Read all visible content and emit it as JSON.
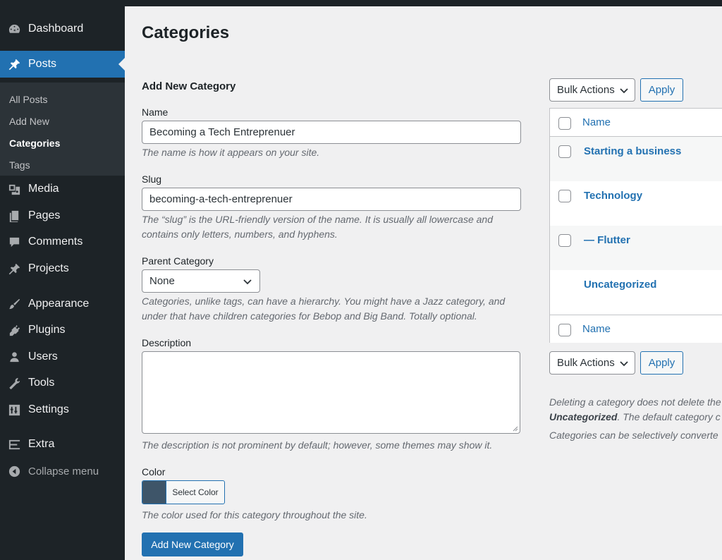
{
  "sidebar": {
    "items": [
      {
        "label": "Dashboard",
        "icon": "dashboard-icon"
      },
      {
        "label": "Posts",
        "icon": "pin-icon"
      },
      {
        "label": "Media",
        "icon": "media-icon"
      },
      {
        "label": "Pages",
        "icon": "pages-icon"
      },
      {
        "label": "Comments",
        "icon": "comments-icon"
      },
      {
        "label": "Projects",
        "icon": "pin-icon"
      },
      {
        "label": "Appearance",
        "icon": "brush-icon"
      },
      {
        "label": "Plugins",
        "icon": "plugin-icon"
      },
      {
        "label": "Users",
        "icon": "user-icon"
      },
      {
        "label": "Tools",
        "icon": "wrench-icon"
      },
      {
        "label": "Settings",
        "icon": "settings-icon"
      },
      {
        "label": "Extra",
        "icon": "extra-icon"
      }
    ],
    "submenu": [
      "All Posts",
      "Add New",
      "Categories",
      "Tags"
    ],
    "collapse_label": "Collapse menu"
  },
  "page": {
    "title": "Categories"
  },
  "form": {
    "title": "Add New Category",
    "name_label": "Name",
    "name_value": "Becoming a Tech Entreprenuer",
    "name_help": "The name is how it appears on your site.",
    "slug_label": "Slug",
    "slug_value": "becoming-a-tech-entreprenuer",
    "slug_help": "The “slug” is the URL-friendly version of the name. It is usually all lowercase and contains only letters, numbers, and hyphens.",
    "parent_label": "Parent Category",
    "parent_value": "None",
    "parent_help": "Categories, unlike tags, can have a hierarchy. You might have a Jazz category, and under that have children categories for Bebop and Big Band. Totally optional.",
    "description_label": "Description",
    "description_help": "The description is not prominent by default; however, some themes may show it.",
    "color_label": "Color",
    "color_button": "Select Color",
    "color_value": "#3e5569",
    "color_help": "The color used for this category throughout the site.",
    "submit_label": "Add New Category"
  },
  "list": {
    "bulk_actions": "Bulk Actions",
    "apply": "Apply",
    "column_name": "Name",
    "rows": [
      "Starting a business",
      "Technology",
      "— Flutter",
      "Uncategorized"
    ],
    "note_1a": "Deleting a category does not delete the",
    "note_1b": "Uncategorized",
    "note_1c": ". The default category c",
    "note_2": "Categories can be selectively converte"
  },
  "colors": {
    "accent": "#2271b1",
    "sidebar_bg": "#1d2327",
    "submenu_bg": "#2c3338",
    "page_bg": "#f0f0f1"
  }
}
